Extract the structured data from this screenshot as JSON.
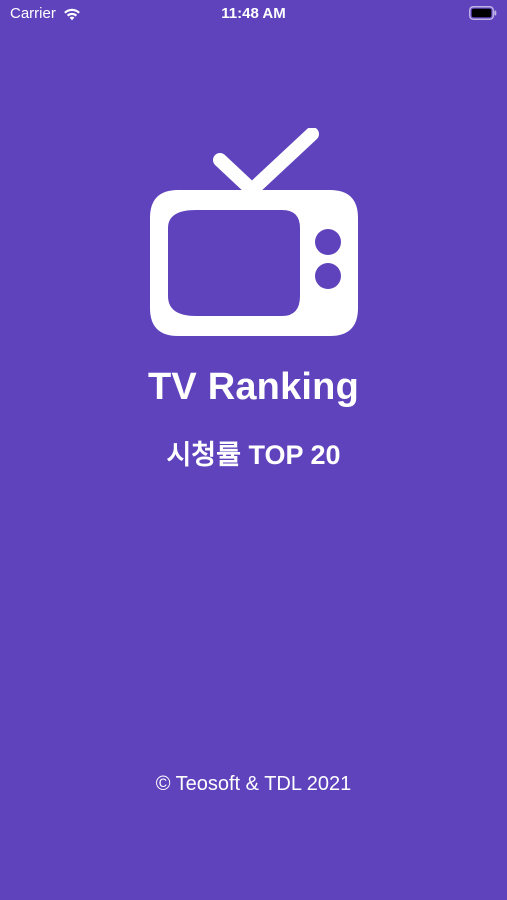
{
  "status_bar": {
    "carrier": "Carrier",
    "time": "11:48 AM",
    "icons": [
      "wifi-icon",
      "battery-icon"
    ]
  },
  "splash": {
    "logo_icon": "tv-icon",
    "title": "TV Ranking",
    "subtitle": "시청률 TOP 20",
    "copyright": "© Teosoft & TDL 2021"
  },
  "colors": {
    "background": "#5f43bd",
    "foreground": "#ffffff"
  }
}
